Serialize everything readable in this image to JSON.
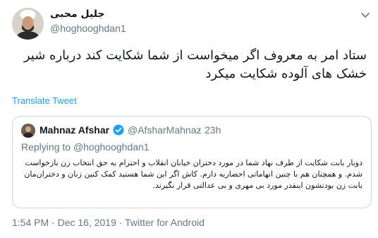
{
  "tweet": {
    "display_name": "جلیل محبی",
    "handle": "@hoghooghdan1",
    "text": "ستاد امر به معروف اگر میخواست از شما شکایت کند درباره شیر خشک های آلوده شکایت میکرد",
    "translate_label": "Translate Tweet",
    "timestamp": "1:54 PM · Dec 16, 2019",
    "separator": "·",
    "source": "Twitter for Android",
    "icons": {
      "avatar": "user-avatar",
      "caret": "chevron-down-icon"
    }
  },
  "quote": {
    "display_name": "Mahnaz Afshar",
    "handle": "@AfsharMahnaz",
    "dot": "·",
    "time": "23h",
    "replying_prefix": "Replying to",
    "replying_handle": "@hoghooghdan1",
    "text": "دوبار بابت شکایت از طرف نهاد شما در مورد دختران خیابان انقلاب و احترام به حق انتخاب زن بازخواست شدم. و همچنان هم با چنین اتهاماتی احضاریه دارم. کاش اگر این شما هستید کمک کنین زنان و دختران‌مان بابت زن بودنشون اینقدر مورد بی مهری و بی عدالتی قرار نگیرند.",
    "verified": true,
    "icons": {
      "verified": "verified-badge-icon"
    }
  },
  "colors": {
    "accent": "#1da1f2",
    "secondary_text": "#657786",
    "border": "#ccd6dd",
    "primary_text": "#14171a"
  }
}
